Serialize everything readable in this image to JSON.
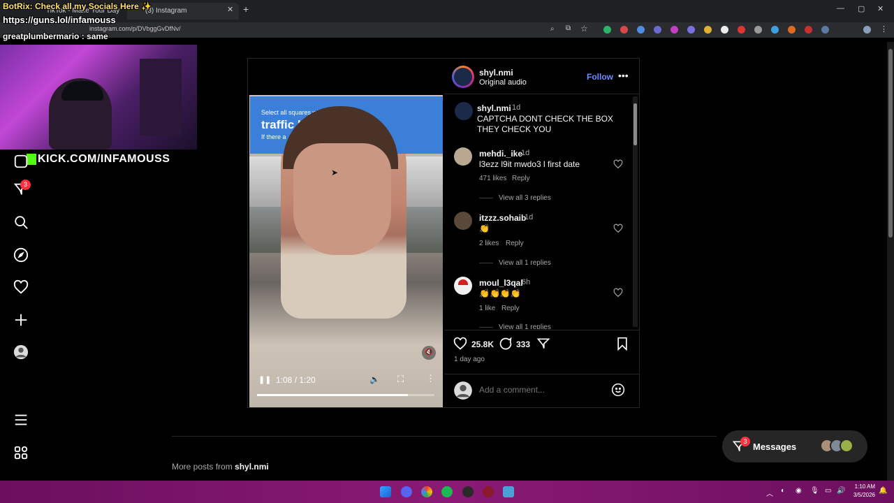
{
  "browser": {
    "tabs": [
      {
        "label": "TikTok - Make Your Day"
      },
      {
        "label": "(3) Instagram"
      }
    ],
    "url": "instagram.com/p/DVbggGvDfNv/"
  },
  "stream_overlay": {
    "botrix_line": "BotRix: Check all my Socials Here ✨",
    "socials_url": "https://guns.lol/infamouss",
    "chat_user": "greatplumbermario",
    "chat_message": "same",
    "kick_banner": "KICK.COM/INFAMOUSS"
  },
  "nav": {
    "notifications_badge": "3"
  },
  "post": {
    "author": "shyl.nmi",
    "audio": "Original audio",
    "follow_label": "Follow",
    "caption": {
      "user": "shyl.nmi",
      "time": "1d",
      "text": "CAPTCHA DONT CHECK THE BOX THEY CHECK YOU"
    },
    "comments": [
      {
        "user": "mehdi._ike",
        "time": "1d",
        "text": "l3ezz l9it mwdo3 l first date",
        "likes": "471 likes",
        "reply": "Reply",
        "view_replies": "View all 3 replies"
      },
      {
        "user": "itzzz.sohaib",
        "time": "1d",
        "text": "👏",
        "likes": "2 likes",
        "reply": "Reply",
        "view_replies": "View all 1 replies"
      },
      {
        "user": "moul_l3qal",
        "time": "6h",
        "text": "👏👏👏👏",
        "likes": "1 like",
        "reply": "Reply",
        "view_replies": "View all 1 replies"
      }
    ],
    "like_count": "25.8K",
    "comment_count": "333",
    "posted": "1 day ago",
    "add_comment_placeholder": "Add a comment...",
    "video": {
      "time": "1:08 / 1:20",
      "progress": 0.85,
      "captcha_line1": "Select all squares with",
      "captcha_line2": "traffic l",
      "captcha_line3": "If there a"
    }
  },
  "more_posts": {
    "prefix": "More posts from ",
    "user": "shyl.nmi"
  },
  "messages": {
    "label": "Messages",
    "badge": "3"
  },
  "taskbar": {
    "time": "1:10 AM",
    "date": "3/5/2026"
  },
  "colors": {
    "accent_link": "#708dff",
    "badge_red": "#ff3040",
    "taskbar": "#8a1a75"
  }
}
